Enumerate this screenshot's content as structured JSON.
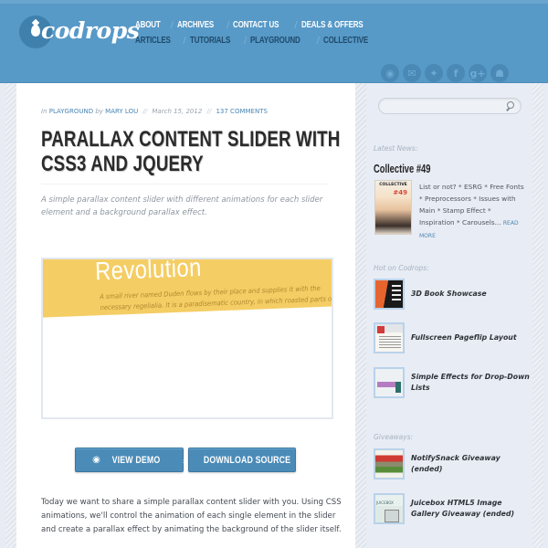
{
  "header": {
    "logo_text": "codrops",
    "nav_top": [
      "About",
      "Archives",
      "Contact Us",
      "Deals & Offers"
    ],
    "nav_bottom": [
      "Articles",
      "Tutorials",
      "Playground",
      "Collective"
    ],
    "nav_separator": "/",
    "social": [
      {
        "name": "rss",
        "glyph": "◉"
      },
      {
        "name": "email",
        "glyph": "✉"
      },
      {
        "name": "twitter",
        "glyph": "✦"
      },
      {
        "name": "facebook",
        "glyph": "f"
      },
      {
        "name": "google-plus",
        "glyph": "g+"
      },
      {
        "name": "github",
        "glyph": "☗"
      }
    ]
  },
  "article": {
    "meta": {
      "in_label": "In",
      "category": "Playground",
      "by_label": "by",
      "author": "Mary Lou",
      "separator": "//",
      "date": "March 15, 2012",
      "comments": "137 Comments"
    },
    "title": "Parallax Content Slider with CSS3 and jQuery",
    "summary": "A simple parallax content slider with different animations for each slider element and a background parallax effect.",
    "slider": {
      "heading": "Revolution",
      "text": "A small river named Duden flows by their place and supplies it with the necessary regelialia. It is a paradisematic country, in which roasted parts of sentences fly into"
    },
    "buttons": {
      "demo_label": "View Demo",
      "download_label": "Download Source"
    },
    "body": "Today we want to share a simple parallax content slider with you. Using CSS animations, we'll control the animation of each single element in the slider and create a parallax effect by animating the background of the slider itself."
  },
  "sidebar": {
    "search": {
      "placeholder": "",
      "value": ""
    },
    "latest_news_label": "Latest News:",
    "news": {
      "title": "Collective #49",
      "image_label": "COLLECTIVE",
      "image_number": "#49",
      "text": "List or not? * ESRG * Free Fonts * Preprocessors * Issues with Main * Stamp Effect * Inspiration * Carousels...",
      "read_more": "Read More"
    },
    "hot_label": "Hot on Codrops:",
    "hot_items": [
      {
        "title": "3D Book Showcase"
      },
      {
        "title": "Fullscreen Pageflip Layout"
      },
      {
        "title": "Simple Effects for Drop-Down Lists"
      }
    ],
    "giveaways_label": "Giveaways:",
    "giveaways": [
      {
        "title": "NotifySnack Giveaway (ended)"
      },
      {
        "title": "Juicebox HTML5 Image Gallery Giveaway (ended)"
      }
    ]
  },
  "colors": {
    "header_bg": "#5799c7",
    "accent": "#4a8bb8",
    "link": "#4a86b3",
    "slider_band": "#f4cd64"
  }
}
